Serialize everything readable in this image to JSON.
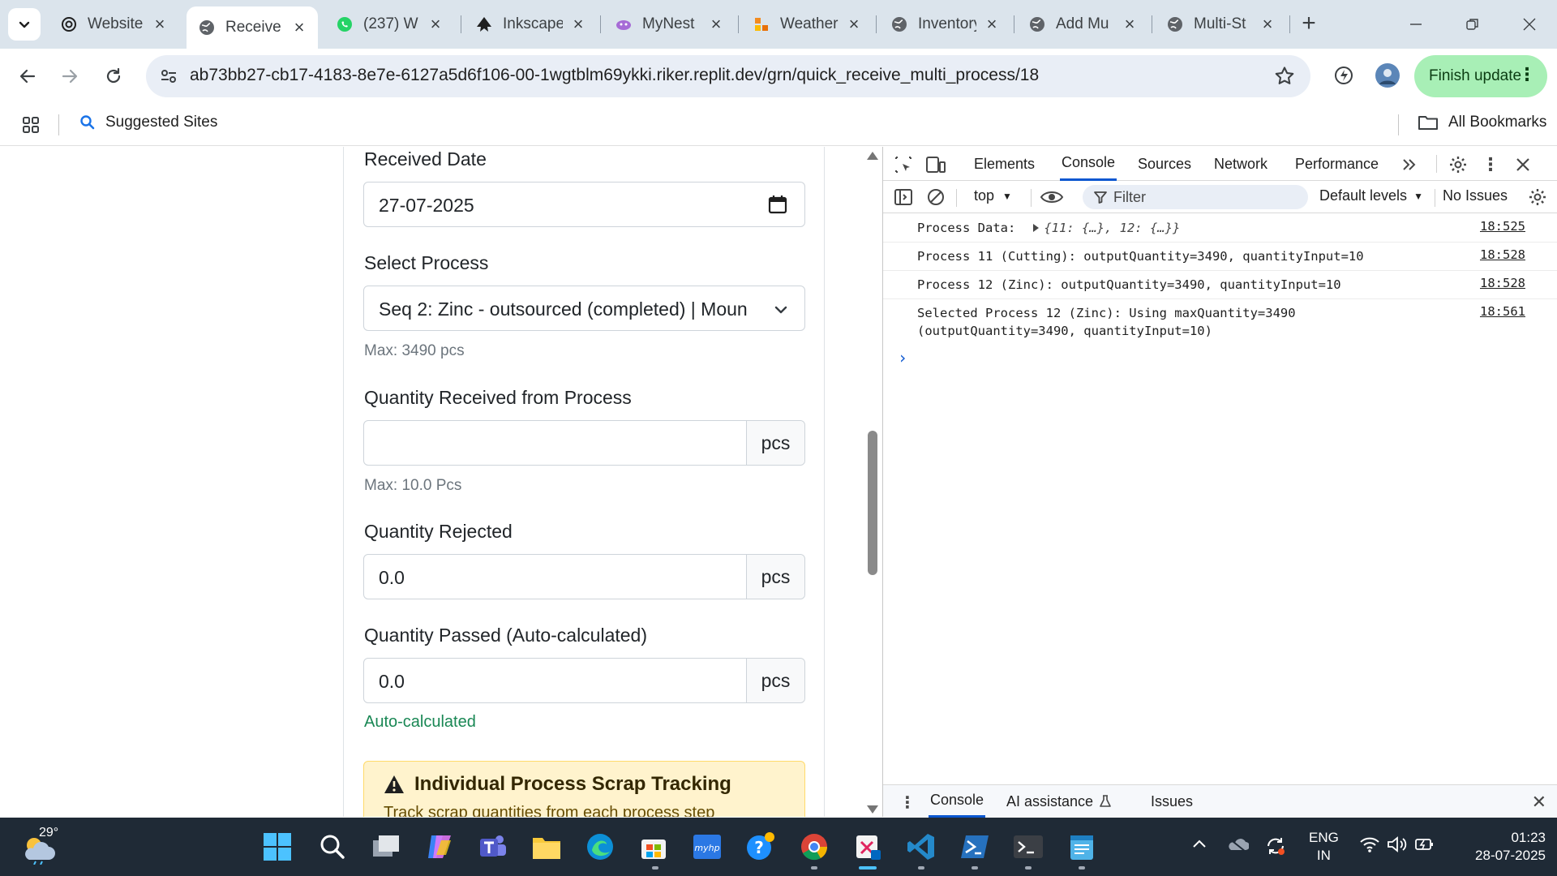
{
  "browser": {
    "tabs": [
      {
        "title": "Website",
        "icon": "chatgpt-icon"
      },
      {
        "title": "Receive",
        "icon": "globe-icon",
        "active": true
      },
      {
        "title": "(237) W",
        "icon": "whatsapp-icon"
      },
      {
        "title": "Inkscape",
        "icon": "inkscape-icon"
      },
      {
        "title": "MyNest",
        "icon": "mynest-icon"
      },
      {
        "title": "Weather",
        "icon": "weather-app-icon"
      },
      {
        "title": "Inventory",
        "icon": "globe-icon"
      },
      {
        "title": "Add Mu",
        "icon": "globe-icon"
      },
      {
        "title": "Multi-St",
        "icon": "globe-icon"
      }
    ],
    "url": "ab73bb27-cb17-4183-8e7e-6127a5d6f106-00-1wgtblm69ykki.riker.replit.dev/grn/quick_receive_multi_process/18",
    "finish_update_label": "Finish update",
    "bookmarks": {
      "suggested": "Suggested Sites",
      "all": "All Bookmarks"
    }
  },
  "form": {
    "received_date": {
      "label": "Received Date",
      "value": "27-07-2025"
    },
    "select_process": {
      "label": "Select Process",
      "value": "Seq 2: Zinc - outsourced (completed) | Moun",
      "hint": "Max: 3490 pcs"
    },
    "qty_received": {
      "label": "Quantity Received from Process",
      "value": "",
      "unit": "pcs",
      "hint": "Max: 10.0 Pcs"
    },
    "qty_rejected": {
      "label": "Quantity Rejected",
      "value": "0.0",
      "unit": "pcs"
    },
    "qty_passed": {
      "label": "Quantity Passed (Auto-calculated)",
      "value": "0.0",
      "unit": "pcs",
      "hint": "Auto-calculated"
    },
    "scrap_alert": {
      "title": "Individual Process Scrap Tracking",
      "subtitle": "Track scrap quantities from each process step"
    }
  },
  "devtools": {
    "tabs": [
      "Elements",
      "Console",
      "Sources",
      "Network",
      "Performance"
    ],
    "active_tab": "Console",
    "context": "top",
    "filter_placeholder": "Filter",
    "levels": "Default levels",
    "issues": "No Issues",
    "logs": [
      {
        "label": "Process Data:",
        "object": "{11: {…}, 12: {…}}",
        "source": "18:525"
      },
      {
        "text": "Process 11 (Cutting): outputQuantity=3490, quantityInput=10",
        "source": "18:528"
      },
      {
        "text": "Process 12 (Zinc): outputQuantity=3490, quantityInput=10",
        "source": "18:528"
      },
      {
        "text": "Selected Process 12 (Zinc): Using maxQuantity=3490\n(outputQuantity=3490, quantityInput=10)",
        "source": "18:561"
      }
    ],
    "prompt": "›",
    "drawer_tabs": [
      "Console",
      "AI assistance",
      "Issues"
    ]
  },
  "taskbar": {
    "temperature": "29°",
    "lang_line1": "ENG",
    "lang_line2": "IN",
    "time": "01:23",
    "date": "28-07-2025"
  },
  "colors": {
    "accent_blue": "#0b57d0",
    "finish_update_bg": "#a8efb6",
    "alert_bg": "#fff3cd",
    "success_green": "#198754",
    "taskbar_bg": "#1f2a36"
  }
}
